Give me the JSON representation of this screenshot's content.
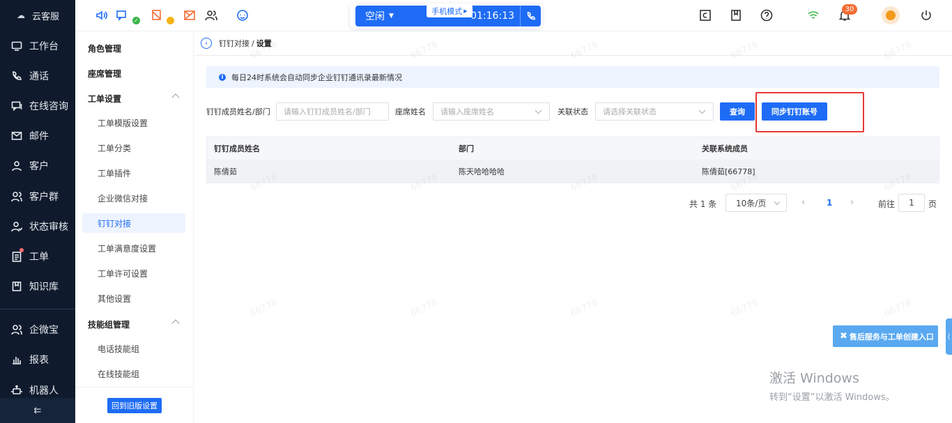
{
  "nav": {
    "brand": "云客服",
    "items": [
      {
        "label": "工作台",
        "icon": "monitor-icon"
      },
      {
        "label": "通话",
        "icon": "phone-icon"
      },
      {
        "label": "在线咨询",
        "icon": "chat-icon"
      },
      {
        "label": "邮件",
        "icon": "mail-icon"
      },
      {
        "label": "客户",
        "icon": "user-icon"
      },
      {
        "label": "客户群",
        "icon": "users-icon"
      },
      {
        "label": "状态审核",
        "icon": "user-check-icon"
      },
      {
        "label": "工单",
        "icon": "ticket-icon"
      },
      {
        "label": "知识库",
        "icon": "book-icon"
      },
      {
        "label": "企微宝",
        "icon": "users-icon"
      },
      {
        "label": "报表",
        "icon": "bar-chart-icon"
      },
      {
        "label": "机器人",
        "icon": "robot-icon"
      }
    ],
    "collapse_glyph": "⇇"
  },
  "header": {
    "status": "空闲",
    "mode": "手机模式",
    "timer": "01:16:13",
    "notification_count": "30",
    "colors": {
      "accent": "#1e6cf5",
      "ok": "#3bb54a",
      "warn": "#f5b316",
      "alert": "#f56c34"
    }
  },
  "submenu": {
    "items": [
      {
        "label": "角色管理",
        "type": "group"
      },
      {
        "label": "座席管理",
        "type": "group"
      },
      {
        "label": "工单设置",
        "type": "group",
        "expanded": true
      },
      {
        "label": "工单模版设置",
        "type": "child"
      },
      {
        "label": "工单分类",
        "type": "child"
      },
      {
        "label": "工单插件",
        "type": "child"
      },
      {
        "label": "企业微信对接",
        "type": "child"
      },
      {
        "label": "钉钉对接",
        "type": "child",
        "active": true
      },
      {
        "label": "工单满意度设置",
        "type": "child"
      },
      {
        "label": "工单许可设置",
        "type": "child"
      },
      {
        "label": "其他设置",
        "type": "child"
      },
      {
        "label": "技能组管理",
        "type": "group",
        "expanded": true
      },
      {
        "label": "电话技能组",
        "type": "child"
      },
      {
        "label": "在线技能组",
        "type": "child"
      }
    ],
    "footer_button": "回到旧版设置"
  },
  "breadcrumb": {
    "parent": "钉钉对接",
    "separator": "/",
    "current": "设置"
  },
  "notice": "每日24时系统会自动同步企业钉钉通讯录最新情况",
  "filters": {
    "member_label": "钉钉成员姓名/部门",
    "member_placeholder": "请输入钉钉成员姓名/部门",
    "agent_label": "座席姓名",
    "agent_placeholder": "请输入座席姓名",
    "status_label": "关联状态",
    "status_placeholder": "请选择关联状态",
    "query_button": "查询",
    "sync_button": "同步钉钉账号"
  },
  "table": {
    "columns": [
      "钉钉成员姓名",
      "部门",
      "关联系统成员"
    ],
    "rows": [
      [
        "陈倩茹",
        "陈天哈哈哈哈",
        "陈倩茹[66778]"
      ]
    ]
  },
  "pagination": {
    "total": "共 1 条",
    "page_size": "10条/页",
    "current": "1",
    "goto_label": "前往",
    "goto_value": "1",
    "unit": "页"
  },
  "watermark": "66778",
  "after_sale": "售后服务与工单创建入口",
  "side_tab": "⟨",
  "windows": {
    "line1": "激活 Windows",
    "line2": "转到“设置”以激活 Windows。"
  }
}
